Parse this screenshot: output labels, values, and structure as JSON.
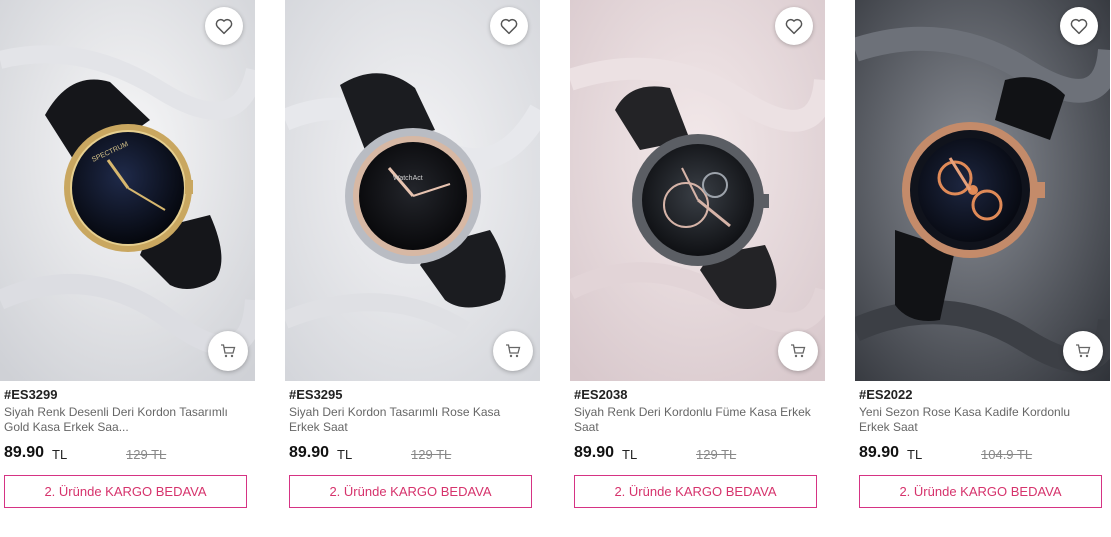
{
  "products": [
    {
      "code": "#ES3299",
      "title": "Siyah Renk Desenli Deri Kordon Tasarımlı Gold Kasa Erkek Saa...",
      "price": "89.90",
      "currency": "TL",
      "old_price": "129 TL",
      "promo": "2. Üründe KARGO BEDAVA",
      "watch_label": "SPECTRUM"
    },
    {
      "code": "#ES3295",
      "title": "Siyah Deri Kordon Tasarımlı Rose Kasa Erkek Saat",
      "price": "89.90",
      "currency": "TL",
      "old_price": "129 TL",
      "promo": "2. Üründe KARGO BEDAVA",
      "watch_label": "WatchAct"
    },
    {
      "code": "#ES2038",
      "title": "Siyah Renk Deri Kordonlu Füme Kasa Erkek Saat",
      "price": "89.90",
      "currency": "TL",
      "old_price": "129 TL",
      "promo": "2. Üründe KARGO BEDAVA",
      "watch_label": ""
    },
    {
      "code": "#ES2022",
      "title": "Yeni Sezon Rose Kasa Kadife Kordonlu Erkek Saat",
      "price": "89.90",
      "currency": "TL",
      "old_price": "104.9 TL",
      "promo": "2. Üründe KARGO BEDAVA",
      "watch_label": ""
    }
  ],
  "icons": {
    "favorite": "heart-icon",
    "cart": "cart-icon"
  },
  "colors": {
    "accent": "#d6336c",
    "price": "#111111",
    "old_price": "#888888"
  }
}
